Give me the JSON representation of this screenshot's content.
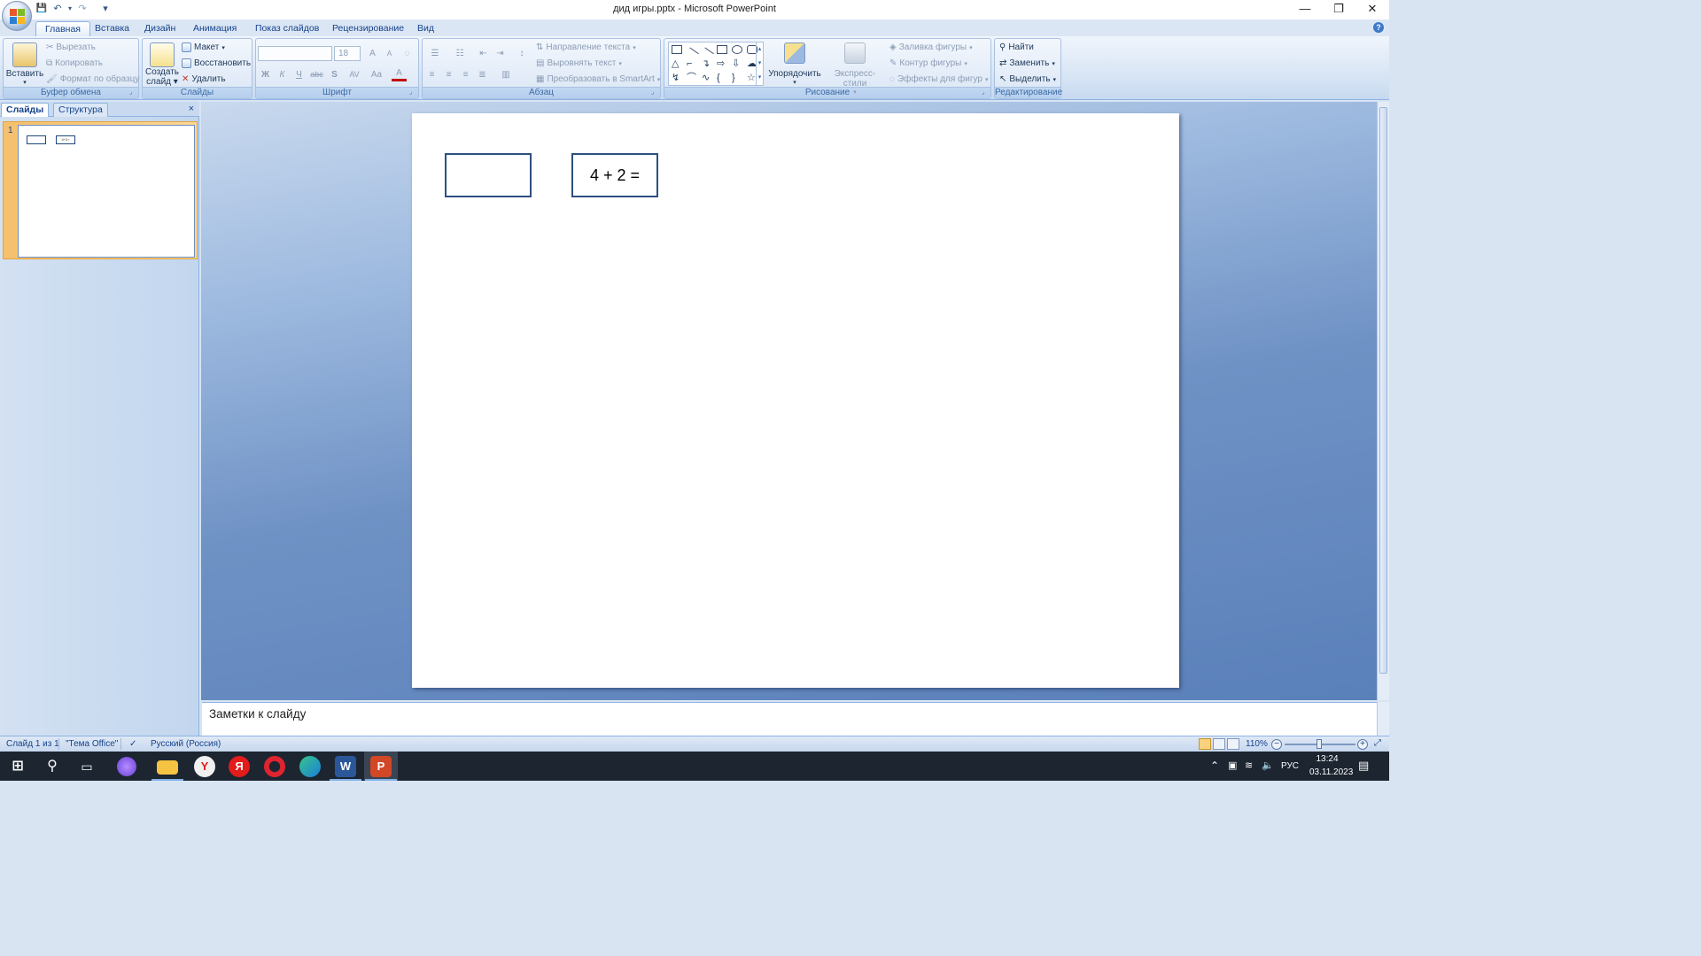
{
  "window": {
    "title": "дид игры.pptx - Microsoft PowerPoint",
    "minimize": "—",
    "restore": "❐",
    "close": "✕"
  },
  "qat": {
    "save": "💾",
    "undo": "↶",
    "redo": "↷",
    "customize": "▾"
  },
  "tabs": [
    "Главная",
    "Вставка",
    "Дизайн",
    "Анимация",
    "Показ слайдов",
    "Рецензирование",
    "Вид"
  ],
  "help": "?",
  "ribbon": {
    "clipboard": {
      "label": "Буфер обмена",
      "paste": "Вставить",
      "cut": "Вырезать",
      "copy": "Копировать",
      "format_painter": "Формат по образцу"
    },
    "slides": {
      "label": "Слайды",
      "new_slide_line1": "Создать",
      "new_slide_line2": "слайд",
      "layout": "Макет",
      "reset": "Восстановить",
      "delete": "Удалить"
    },
    "font": {
      "label": "Шрифт",
      "font_name": "",
      "font_size": "18",
      "grow": "A",
      "shrink": "A",
      "bold": "Ж",
      "italic": "К",
      "underline": "Ч",
      "strike": "abc",
      "shadow": "S",
      "spacing": "AV",
      "case": "Aa",
      "color": "A"
    },
    "paragraph": {
      "label": "Абзац",
      "text_direction": "Направление текста",
      "align_text": "Выровнять текст",
      "smartart": "Преобразовать в SmartArt"
    },
    "drawing": {
      "label": "Рисование",
      "arrange": "Упорядочить",
      "quick_styles": "Экспресс-стили",
      "shape_fill": "Заливка фигуры",
      "shape_outline": "Контур фигуры",
      "shape_effects": "Эффекты для фигур"
    },
    "editing": {
      "label": "Редактирование",
      "find": "Найти",
      "replace": "Заменить",
      "select": "Выделить"
    }
  },
  "left_pane": {
    "tab_slides": "Слайды",
    "tab_outline": "Структура",
    "close": "×",
    "slide_number": "1",
    "thumb_box_text": "4+2="
  },
  "slide": {
    "box1_text": "",
    "box2_text": "4 + 2 ="
  },
  "notes": {
    "placeholder": "Заметки к слайду"
  },
  "status": {
    "slide_info": "Слайд 1 из 1",
    "theme": "\"Тема Office\"",
    "language": "Русский (Россия)",
    "zoom": "110%",
    "zoom_minus": "−",
    "zoom_plus": "+"
  },
  "taskbar": {
    "language": "РУС",
    "time": "13:24",
    "date": "03.11.2023"
  }
}
